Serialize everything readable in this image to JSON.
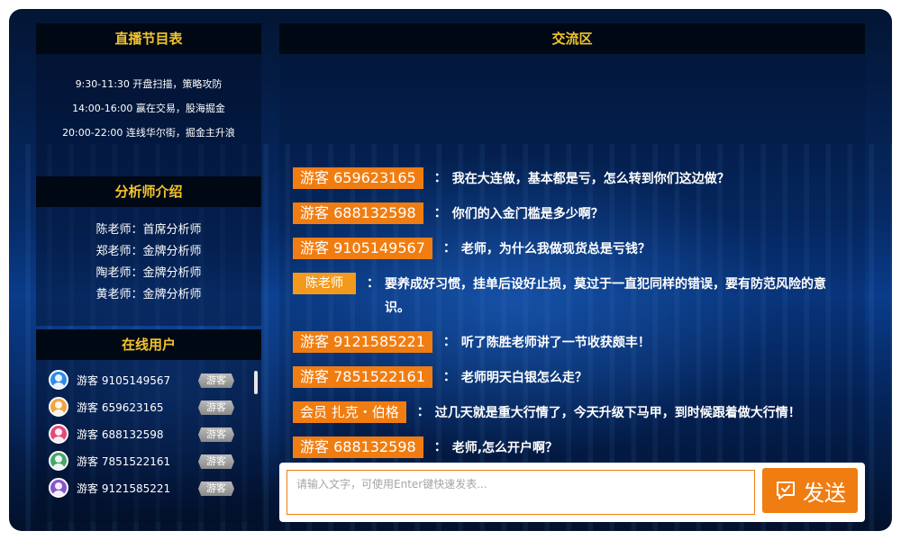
{
  "schedule": {
    "title": "直播节目表",
    "items": [
      "9:30-11:30 开盘扫描，策略攻防",
      "14:00-16:00 赢在交易，股海掘金",
      "20:00-22:00 连线华尔街，掘金主升浪"
    ]
  },
  "analysts": {
    "title": "分析师介绍",
    "items": [
      "陈老师：首席分析师",
      "郑老师：金牌分析师",
      "陶老师：金牌分析师",
      "黄老师：金牌分析师"
    ]
  },
  "online": {
    "title": "在线用户",
    "users": [
      {
        "name": "游客 9105149567",
        "badge": "游客",
        "avatar_color": "#2f8be8"
      },
      {
        "name": "游客 659623165",
        "badge": "游客",
        "avatar_color": "#f2a640"
      },
      {
        "name": "游客 688132598",
        "badge": "游客",
        "avatar_color": "#e24a7a"
      },
      {
        "name": "游客 7851522161",
        "badge": "游客",
        "avatar_color": "#4aa56e"
      },
      {
        "name": "游客 9121585221",
        "badge": "游客",
        "avatar_color": "#8a55c9"
      }
    ]
  },
  "chat": {
    "title": "交流区",
    "messages": [
      {
        "sender": "游客 659623165",
        "role": "guest",
        "text": "我在大连做，基本都是亏，怎么转到你们这边做？"
      },
      {
        "sender": "游客 688132598",
        "role": "guest",
        "text": "你们的入金门槛是多少啊？"
      },
      {
        "sender": "游客 9105149567",
        "role": "guest",
        "text": "老师，为什么我做现货总是亏钱？"
      },
      {
        "sender": "陈老师",
        "role": "teacher",
        "text": "要养成好习惯，挂单后设好止损，莫过于一直犯同样的错误，要有防范风险的意识。"
      },
      {
        "sender": "游客 9121585221",
        "role": "guest",
        "text": "听了陈胜老师讲了一节收获颇丰！"
      },
      {
        "sender": "游客 7851522161",
        "role": "guest",
        "text": "老师明天白银怎么走？"
      },
      {
        "sender": "会员  扎克・伯格",
        "role": "member",
        "text": "过几天就是重大行情了，今天升级下马甲，到时候跟着做大行情！"
      },
      {
        "sender": "游客 688132598",
        "role": "guest",
        "text": "老师,怎么开户啊？"
      }
    ]
  },
  "composer": {
    "placeholder": "请输入文字，可使用Enter键快速发表...",
    "send_label": "发送"
  },
  "colors": {
    "accent": "#f07d12",
    "title_gold": "#f3c52c",
    "header_bg": "#000814"
  }
}
